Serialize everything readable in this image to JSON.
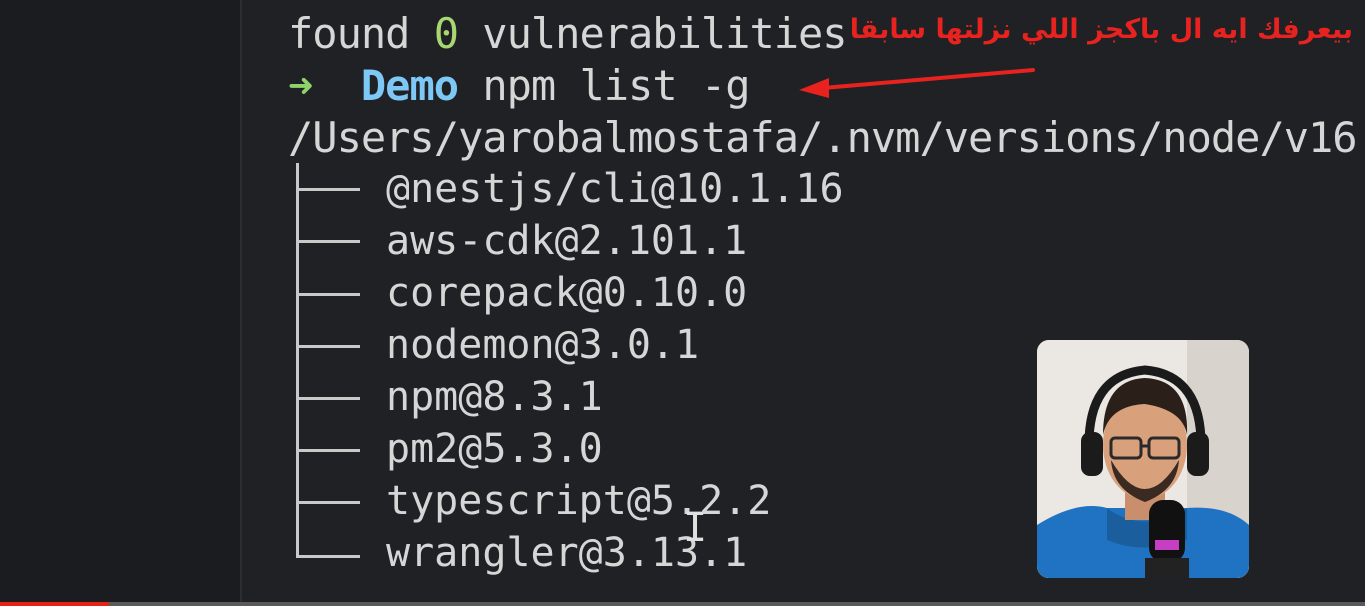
{
  "terminal": {
    "found_prefix": "found ",
    "found_count": "0",
    "found_suffix": " vulnerabilities",
    "prompt_arrow": "➜",
    "prompt_dir": "Demo",
    "command": "npm list -g",
    "path": "/Users/yarobalmostafa/.nvm/versions/node/v16",
    "packages": [
      "@nestjs/cli@10.1.16",
      "aws-cdk@2.101.1",
      "corepack@0.10.0",
      "nodemon@3.0.1",
      "npm@8.3.1",
      "pm2@5.3.0",
      "typescript@5.2.2",
      "wrangler@3.13.1"
    ]
  },
  "annotation": {
    "text": "بيعرفك ايه ال باكجز اللي نزلتها سابقا",
    "color": "#e8231f"
  },
  "colors": {
    "background": "#1f2124",
    "text": "#d6d6d6",
    "prompt_dir": "#7ec8f5",
    "prompt_arrow": "#8fd16a",
    "accent_number": "#a8d66f",
    "progress": "#e62117"
  },
  "video": {
    "progress_percent": 8
  }
}
